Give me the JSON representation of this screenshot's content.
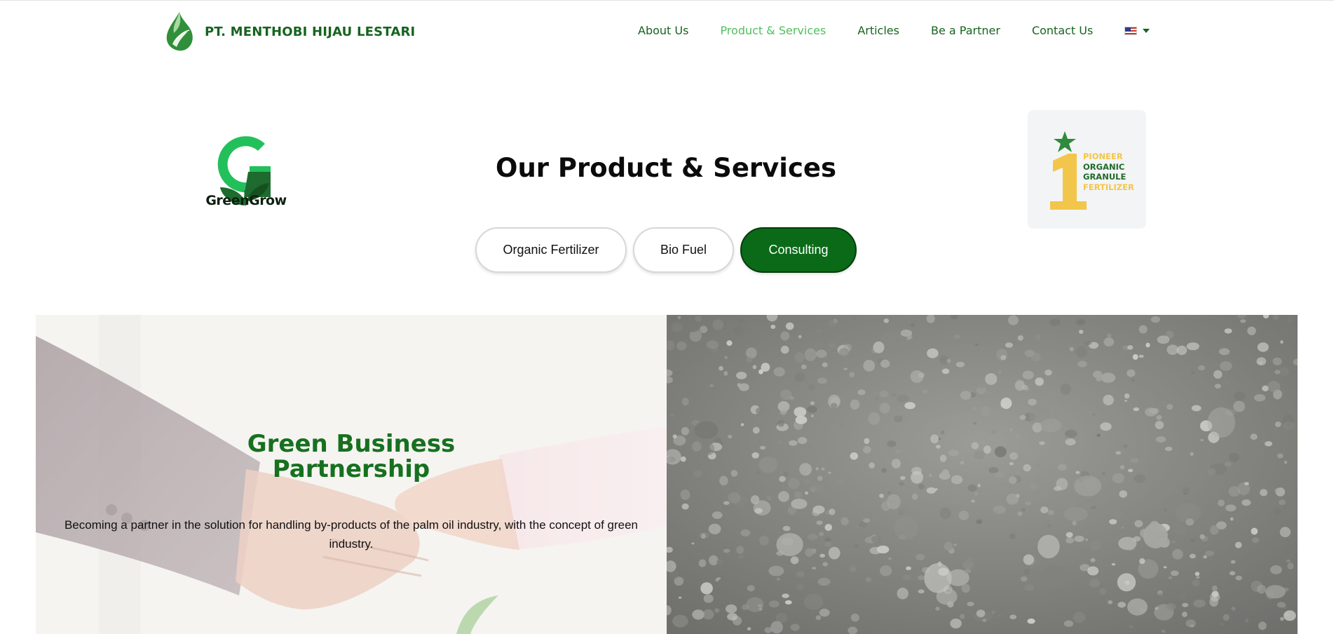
{
  "header": {
    "company_name": "PT. MENTHOBI HIJAU LESTARI",
    "nav": [
      {
        "label": "About Us",
        "active": false
      },
      {
        "label": "Product & Services",
        "active": true
      },
      {
        "label": "Articles",
        "active": false
      },
      {
        "label": "Be a Partner",
        "active": false
      },
      {
        "label": "Contact Us",
        "active": false
      }
    ],
    "language_icon": "us-flag-icon"
  },
  "hero": {
    "brand_logo_text": "GreenGrow",
    "title": "Our Product & Services",
    "tabs": [
      {
        "label": "Organic Fertilizer",
        "selected": false
      },
      {
        "label": "Bio Fuel",
        "selected": false
      },
      {
        "label": "Consulting",
        "selected": true
      }
    ],
    "badge": {
      "number": "1",
      "line1": "PIONEER",
      "line2": "ORGANIC",
      "line3": "GRANULE",
      "line4": "FERTILIZER"
    }
  },
  "content": {
    "title_line1": "Green Business",
    "title_line2": "Partnership",
    "description": "Becoming a partner in the solution for handling by-products of the palm oil industry, with the concept of green industry."
  },
  "colors": {
    "brand_green": "#17631f",
    "active_nav": "#4fbf5c",
    "selected_tab": "#0a6a18",
    "badge_yellow": "#f2c64a"
  }
}
